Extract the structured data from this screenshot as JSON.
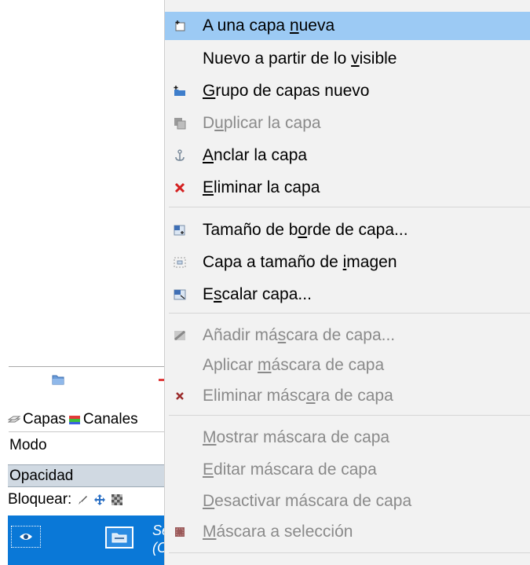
{
  "panel": {
    "tabs": [
      {
        "label": "Capas",
        "icon": "layers-tab-icon"
      },
      {
        "label": "Canales",
        "icon": "channels-tab-icon"
      }
    ],
    "mode_label": "Modo",
    "opacity_label": "Opacidad",
    "lock_label": "Bloquear:",
    "lock_icons": [
      "paint-brush-icon",
      "move-arrows-icon",
      "checker-alpha-icon"
    ],
    "layer": {
      "name_line1": "Se",
      "name_line2": "(C"
    },
    "colors": {
      "selected_row": "#0a78d7",
      "opacity_bg": "#d0d9e2"
    }
  },
  "menu": {
    "highlight_color": "#9ccaf4",
    "items": [
      {
        "pre": "A una capa ",
        "u": "n",
        "post": "ueva",
        "icon": "new-layer-icon",
        "enabled": true,
        "highlighted": true
      },
      {
        "pre": "Nuevo a partir de lo ",
        "u": "v",
        "post": "isible",
        "icon": "",
        "enabled": true
      },
      {
        "pre": "",
        "u": "G",
        "post": "rupo de capas nuevo",
        "icon": "new-layer-group-icon",
        "enabled": true
      },
      {
        "pre": "D",
        "u": "u",
        "post": "plicar la capa",
        "icon": "duplicate-layer-icon",
        "enabled": false
      },
      {
        "pre": "",
        "u": "A",
        "post": "nclar la capa",
        "icon": "anchor-icon",
        "enabled": true
      },
      {
        "pre": "",
        "u": "E",
        "post": "liminar la capa",
        "icon": "delete-red-x-icon",
        "enabled": true
      },
      {
        "pre": "Tamaño de b",
        "u": "o",
        "post": "rde de capa...",
        "icon": "layer-boundary-size-icon",
        "enabled": true
      },
      {
        "pre": "Capa a tamaño de ",
        "u": "i",
        "post": "magen",
        "icon": "layer-to-image-size-icon",
        "enabled": true
      },
      {
        "pre": "E",
        "u": "s",
        "post": "calar capa...",
        "icon": "scale-layer-icon",
        "enabled": true
      },
      {
        "pre": "Añadir má",
        "u": "s",
        "post": "cara de capa...",
        "icon": "add-mask-icon",
        "enabled": false
      },
      {
        "pre": "Aplicar ",
        "u": "m",
        "post": "áscara de capa",
        "icon": "",
        "enabled": false
      },
      {
        "pre": "Eliminar másc",
        "u": "a",
        "post": "ra de capa",
        "icon": "delete-mask-x-icon",
        "enabled": false
      },
      {
        "pre": "",
        "u": "M",
        "post": "ostrar máscara de capa",
        "icon": "",
        "enabled": false
      },
      {
        "pre": "",
        "u": "E",
        "post": "ditar máscara de capa",
        "icon": "",
        "enabled": false
      },
      {
        "pre": "",
        "u": "D",
        "post": "esactivar máscara de capa",
        "icon": "",
        "enabled": false
      },
      {
        "pre": "",
        "u": "M",
        "post": "áscara a selección",
        "icon": "mask-to-selection-icon",
        "enabled": false
      }
    ]
  }
}
